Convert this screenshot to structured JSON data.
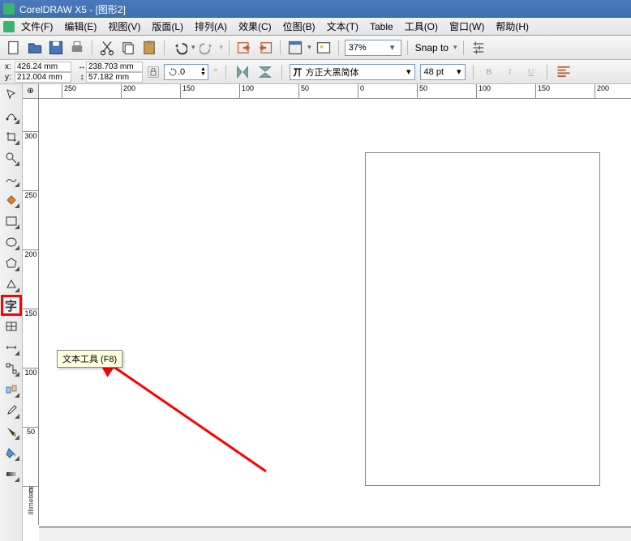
{
  "title": "CorelDRAW X5 - [图形2]",
  "menu": [
    "文件(F)",
    "编辑(E)",
    "视图(V)",
    "版面(L)",
    "排列(A)",
    "效果(C)",
    "位图(B)",
    "文本(T)",
    "Table",
    "工具(O)",
    "窗口(W)",
    "帮助(H)"
  ],
  "toolbar1": {
    "zoom": "37%",
    "snap_label": "Snap to",
    "snap_arrow": "▾"
  },
  "toolbar2": {
    "x_label": "x:",
    "y_label": "y:",
    "x": "426.24 mm",
    "y": "212.004 mm",
    "w_icon": "↔",
    "h_icon": "↕",
    "w": "238.703 mm",
    "h": "57.182 mm",
    "rotate": ".0",
    "font_prefix": "丌",
    "font": "方正大黑简体",
    "size": "48 pt"
  },
  "ruler_h": [
    "250",
    "200",
    "150",
    "100",
    "50",
    "0",
    "50",
    "100",
    "150",
    "200"
  ],
  "ruler_v": [
    "300",
    "250",
    "200",
    "150",
    "100",
    "50",
    "0"
  ],
  "tooltip": "文本工具 (F8)",
  "tool_text_glyph": "字",
  "ruler_corner": "⊕",
  "units_label": "illimeters"
}
